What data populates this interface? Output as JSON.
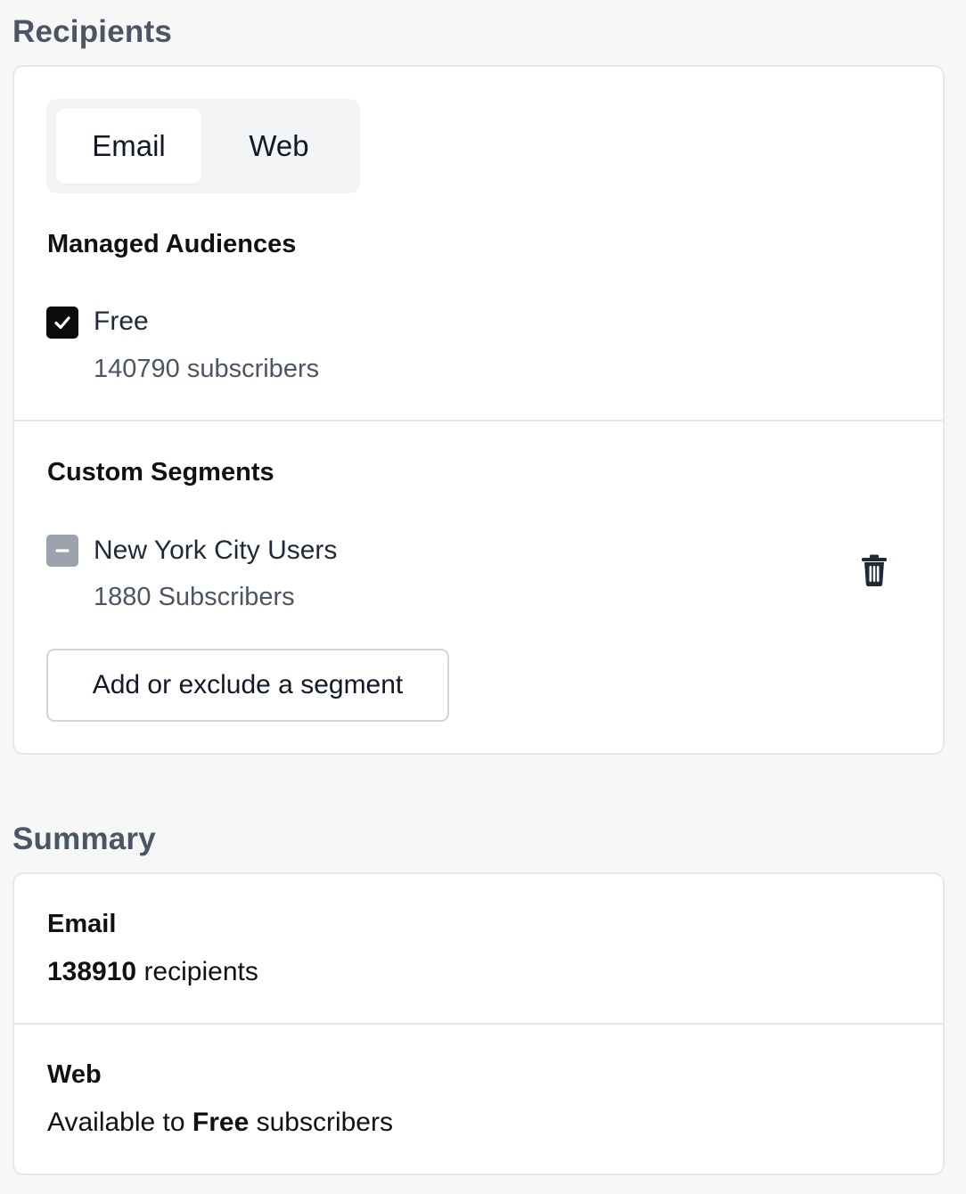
{
  "recipients": {
    "heading": "Recipients",
    "tabs": [
      {
        "label": "Email",
        "selected": true
      },
      {
        "label": "Web",
        "selected": false
      }
    ],
    "managed_audiences": {
      "heading": "Managed Audiences",
      "items": [
        {
          "label": "Free",
          "count": "140790 subscribers",
          "state": "checked"
        }
      ]
    },
    "custom_segments": {
      "heading": "Custom Segments",
      "items": [
        {
          "label": "New York City Users",
          "count": "1880 Subscribers",
          "state": "indeterminate"
        }
      ],
      "add_button": "Add or exclude a segment"
    }
  },
  "summary": {
    "heading": "Summary",
    "email": {
      "heading": "Email",
      "count": "138910",
      "suffix": " recipients"
    },
    "web": {
      "heading": "Web",
      "prefix": "Available to ",
      "tier": "Free",
      "suffix": " subscribers"
    }
  },
  "icons": {
    "checked": "check-icon",
    "indeterminate": "minus-icon",
    "delete": "trash-icon"
  },
  "colors": {
    "heading": "#4b5563",
    "checkbox_checked": "#0b0b0b",
    "checkbox_indeterminate": "#9ca3af",
    "card_border": "#e5e7eb"
  }
}
